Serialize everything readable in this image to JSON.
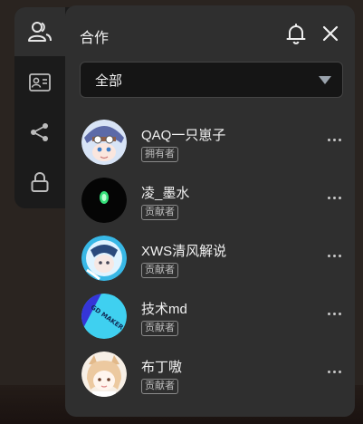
{
  "panel": {
    "title": "合作"
  },
  "filter": {
    "selected": "全部"
  },
  "sidebar": {
    "items": [
      "people-icon",
      "id-card-icon",
      "share-icon",
      "lock-icon"
    ]
  },
  "members": [
    {
      "name": "QAQ一只崽子",
      "role": "拥有者"
    },
    {
      "name": "凌_墨水",
      "role": "贡献者"
    },
    {
      "name": "XWS清风解说",
      "role": "贡献者"
    },
    {
      "name": "技术md",
      "role": "贡献者"
    },
    {
      "name": "布丁嗷",
      "role": "贡献者"
    }
  ],
  "avatar_texts": {
    "member_3": "GD MAKER"
  },
  "colors": {
    "panel": "#2f2f2f",
    "rail": "#1b1b1b",
    "select_bg": "#151515"
  }
}
